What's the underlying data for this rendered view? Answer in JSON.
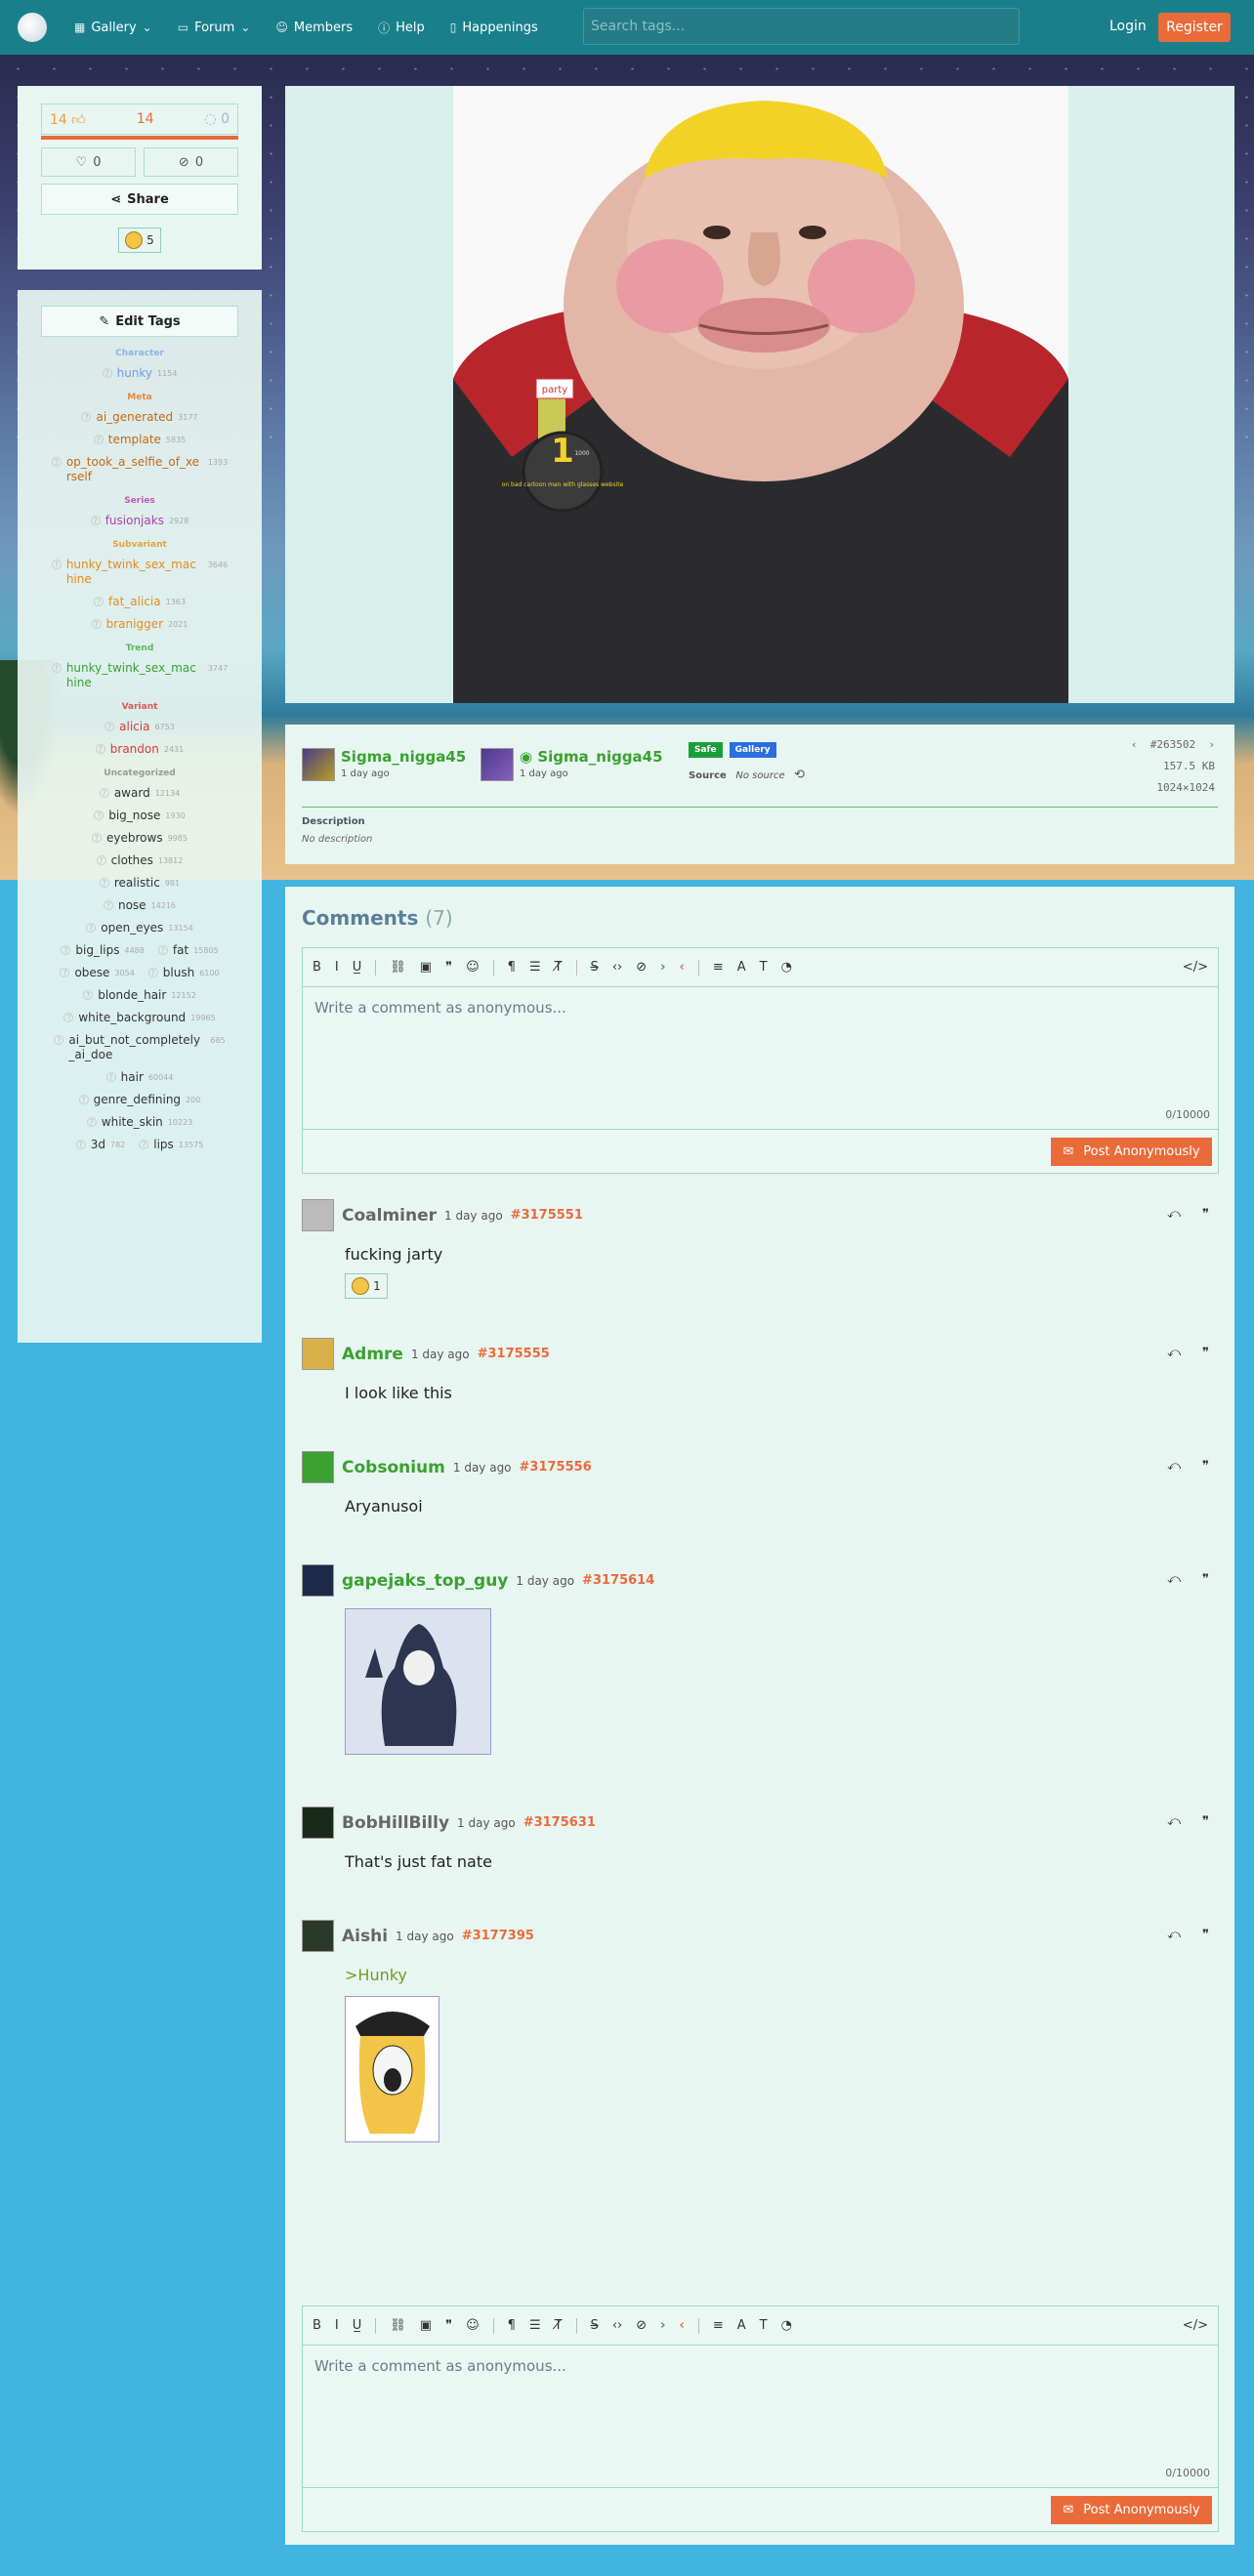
{
  "nav": {
    "items": [
      {
        "label": "Gallery",
        "icon": "grid-icon",
        "dropdown": true
      },
      {
        "label": "Forum",
        "icon": "chat-icon",
        "dropdown": true
      },
      {
        "label": "Members",
        "icon": "user-icon",
        "dropdown": false
      },
      {
        "label": "Help",
        "icon": "question-icon",
        "dropdown": false
      },
      {
        "label": "Happenings",
        "icon": "book-icon",
        "dropdown": false
      }
    ],
    "search_placeholder": "Search tags...",
    "login": "Login",
    "register": "Register"
  },
  "stats": {
    "upvotes": "14",
    "score": "14",
    "comments": "0",
    "favorites": "0",
    "hidden": "0",
    "share_label": "Share",
    "reaction_count": "5"
  },
  "tags_panel": {
    "edit_label": "Edit Tags",
    "categories": [
      {
        "name": "Character",
        "color": "#8fb2e6",
        "rows": [
          [
            {
              "name": "hunky",
              "count": "1154",
              "color": "#6f9fdf"
            }
          ]
        ]
      },
      {
        "name": "Meta",
        "color": "#e6873d",
        "rows": [
          [
            {
              "name": "ai_generated",
              "count": "3177",
              "color": "#c46a12"
            }
          ],
          [
            {
              "name": "template",
              "count": "5835",
              "color": "#c46a12"
            }
          ],
          [
            {
              "name": "op_took_a_selfie_of_xerself",
              "count": "1393",
              "color": "#c46a12"
            }
          ]
        ]
      },
      {
        "name": "Series",
        "color": "#c05ab5",
        "rows": [
          [
            {
              "name": "fusionjaks",
              "count": "2928",
              "color": "#b040a8"
            }
          ]
        ]
      },
      {
        "name": "Subvariant",
        "color": "#e6a23d",
        "rows": [
          [
            {
              "name": "hunky_twink_sex_machine",
              "count": "3646",
              "color": "#e68a1c"
            }
          ],
          [
            {
              "name": "fat_alicia",
              "count": "1363",
              "color": "#e68a1c"
            }
          ],
          [
            {
              "name": "branigger",
              "count": "2021",
              "color": "#e68a1c"
            }
          ]
        ]
      },
      {
        "name": "Trend",
        "color": "#5ab85a",
        "rows": [
          [
            {
              "name": "hunky_twink_sex_machine",
              "count": "3747",
              "color": "#3aa130"
            }
          ]
        ]
      },
      {
        "name": "Variant",
        "color": "#e05555",
        "rows": [
          [
            {
              "name": "alicia",
              "count": "6753",
              "color": "#d93a3a"
            }
          ],
          [
            {
              "name": "brandon",
              "count": "2431",
              "color": "#d93a3a"
            }
          ]
        ]
      },
      {
        "name": "Uncategorized",
        "color": "#999999",
        "rows": [
          [
            {
              "name": "award",
              "count": "12134",
              "color": "#333333"
            }
          ],
          [
            {
              "name": "big_nose",
              "count": "1930",
              "color": "#333333"
            }
          ],
          [
            {
              "name": "eyebrows",
              "count": "9985",
              "color": "#333333"
            }
          ],
          [
            {
              "name": "clothes",
              "count": "13812",
              "color": "#333333"
            }
          ],
          [
            {
              "name": "realistic",
              "count": "981",
              "color": "#333333"
            }
          ],
          [
            {
              "name": "nose",
              "count": "14216",
              "color": "#333333"
            }
          ],
          [
            {
              "name": "open_eyes",
              "count": "13154",
              "color": "#333333"
            }
          ],
          [
            {
              "name": "big_lips",
              "count": "4488",
              "color": "#333333"
            },
            {
              "name": "fat",
              "count": "15805",
              "color": "#333333"
            }
          ],
          [
            {
              "name": "obese",
              "count": "3054",
              "color": "#333333"
            },
            {
              "name": "blush",
              "count": "6100",
              "color": "#333333"
            }
          ],
          [
            {
              "name": "blonde_hair",
              "count": "12152",
              "color": "#333333"
            }
          ],
          [
            {
              "name": "white_background",
              "count": "19965",
              "color": "#333333"
            }
          ],
          [
            {
              "name": "ai_but_not_completely_ai_doe",
              "count": "685",
              "color": "#333333"
            }
          ],
          [
            {
              "name": "hair",
              "count": "60044",
              "color": "#333333"
            }
          ],
          [
            {
              "name": "genre_defining",
              "count": "200",
              "color": "#333333"
            }
          ],
          [
            {
              "name": "white_skin",
              "count": "10223",
              "color": "#333333"
            }
          ],
          [
            {
              "name": "3d",
              "count": "782",
              "color": "#333333"
            },
            {
              "name": "lips",
              "count": "13575",
              "color": "#333333"
            }
          ]
        ]
      }
    ]
  },
  "post": {
    "uploader": {
      "name": "Sigma_nigga45",
      "time": "1 day ago"
    },
    "approver": {
      "name": "Sigma_nigga45",
      "time": "1 day ago"
    },
    "badges": [
      {
        "label": "Safe",
        "color": "#1a9e3a"
      },
      {
        "label": "Gallery",
        "color": "#2a6ee0"
      }
    ],
    "source_label": "Source",
    "source_value": "No source",
    "id": "#263502",
    "size": "157.5 KB",
    "dimensions": "1024×1024",
    "description_label": "Description",
    "description_value": "No description",
    "image_text": {
      "tag": "party",
      "medal_number": "1",
      "medal_small": "1000",
      "medal_caption": "on bad cartoon man with glasses website"
    }
  },
  "comments": {
    "title": "Comments",
    "count": "(7)",
    "placeholder": "Write a comment as anonymous...",
    "counter": "0/10000",
    "post_label": "Post Anonymously",
    "items": [
      {
        "name": "Coalminer",
        "color": "#666666",
        "time": "1 day ago",
        "id": "#3175551",
        "body": "fucking jarty",
        "reaction": "1"
      },
      {
        "name": "Admre",
        "color": "#3aa130",
        "time": "1 day ago",
        "id": "#3175555",
        "body": "I look like this"
      },
      {
        "name": "Cobsonium",
        "color": "#3aa130",
        "time": "1 day ago",
        "id": "#3175556",
        "body": "Aryanusoi"
      },
      {
        "name": "gapejaks_top_guy",
        "color": "#3aa130",
        "time": "1 day ago",
        "id": "#3175614",
        "body": ""
      },
      {
        "name": "BobHillBilly",
        "color": "#666666",
        "time": "1 day ago",
        "id": "#3175631",
        "body": "That's just fat nate"
      },
      {
        "name": "Aishi",
        "color": "#666666",
        "time": "1 day ago",
        "id": "#3177395",
        "body": ">Hunky"
      }
    ]
  }
}
